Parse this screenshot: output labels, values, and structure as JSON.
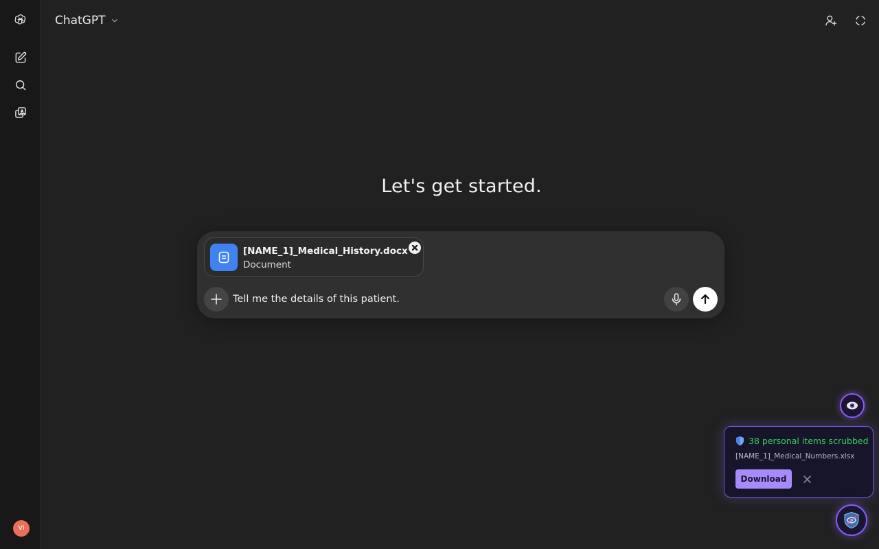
{
  "app": {
    "model_name": "ChatGPT"
  },
  "sidebar": {
    "items": [
      {
        "icon": "openai-logo-icon"
      },
      {
        "icon": "new-chat-icon"
      },
      {
        "icon": "search-icon"
      },
      {
        "icon": "library-icon"
      }
    ],
    "avatar_initials": "VI",
    "avatar_color": "#e8705a"
  },
  "header": {
    "right_icons": [
      "add-person-icon",
      "temporary-chat-icon"
    ]
  },
  "main": {
    "headline": "Let's get started."
  },
  "composer": {
    "attachment": {
      "file_name": "[NAME_1]_Medical_History.docx",
      "file_type": "Document",
      "icon_color": "#3f82f0"
    },
    "input_value": "Tell me the details of this patient.",
    "icons": [
      "plus-icon",
      "microphone-icon",
      "send-arrow-icon"
    ]
  },
  "extension": {
    "notice_title": "38 personal items scrubbed",
    "notice_file": "[NAME_1]_Medical_Numbers.xlsx",
    "download_label": "Download",
    "accent_color": "#8b5cf6",
    "success_color": "#34d058"
  }
}
